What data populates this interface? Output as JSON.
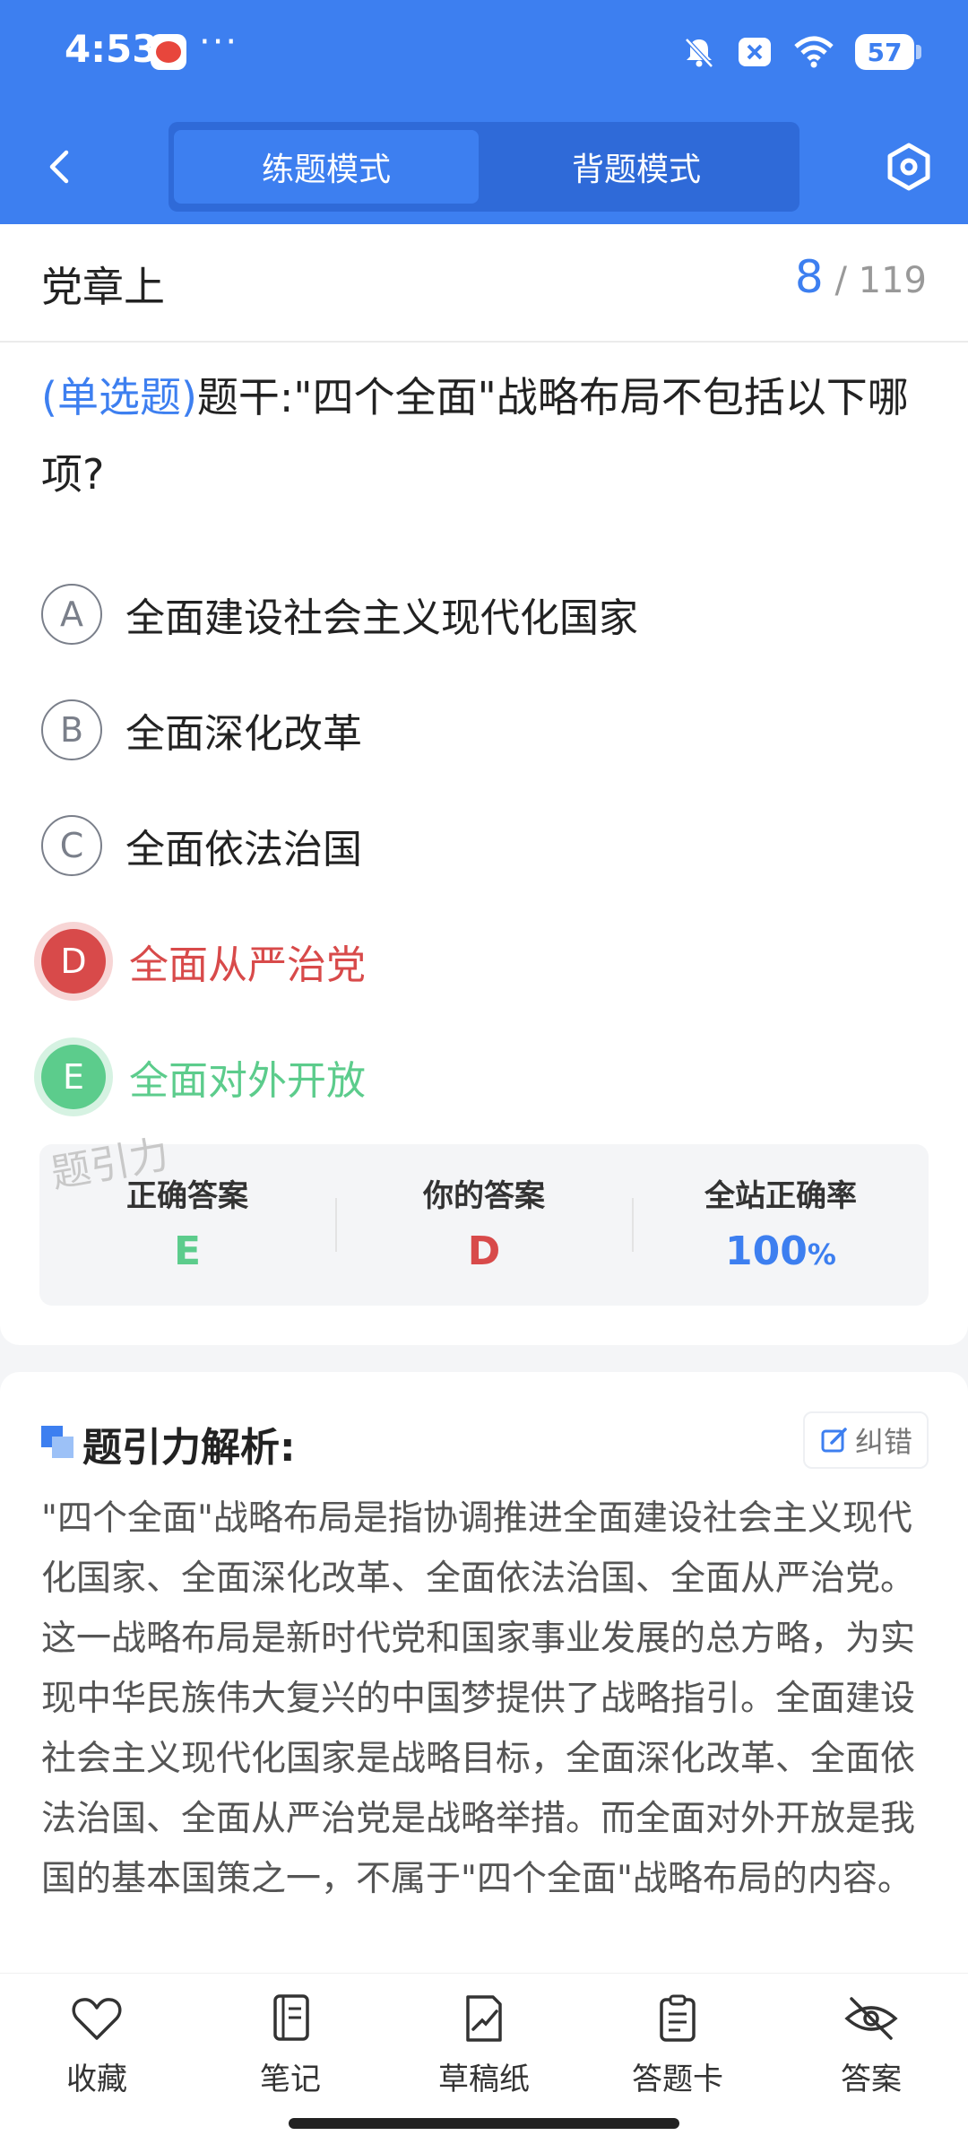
{
  "status_bar": {
    "time": "4:53",
    "dots": "···",
    "battery": "57"
  },
  "nav": {
    "tabs": [
      {
        "label": "练题模式",
        "active": true
      },
      {
        "label": "背题模式",
        "active": false
      }
    ]
  },
  "chapter": {
    "title": "党章上",
    "current": "8",
    "total": "119",
    "separator": " / "
  },
  "question": {
    "type": "(单选题)",
    "stem": "题干:\"四个全面\"战略布局不包括以下哪项?"
  },
  "options": [
    {
      "letter": "A",
      "text": "全面建设社会主义现代化国家",
      "state": "normal"
    },
    {
      "letter": "B",
      "text": "全面深化改革",
      "state": "normal"
    },
    {
      "letter": "C",
      "text": "全面依法治国",
      "state": "normal"
    },
    {
      "letter": "D",
      "text": "全面从严治党",
      "state": "wrong"
    },
    {
      "letter": "E",
      "text": "全面对外开放",
      "state": "correct"
    }
  ],
  "answer_summary": {
    "watermark": "题引力",
    "correct_label": "正确答案",
    "correct_value": "E",
    "yours_label": "你的答案",
    "yours_value": "D",
    "rate_label": "全站正确率",
    "rate_value": "100",
    "rate_unit": "%"
  },
  "analysis": {
    "title": "题引力解析:",
    "fix_label": "纠错",
    "text": "\"四个全面\"战略布局是指协调推进全面建设社会主义现代化国家、全面深化改革、全面依法治国、全面从严治党。这一战略布局是新时代党和国家事业发展的总方略，为实现中华民族伟大复兴的中国梦提供了战略指引。全面建设社会主义现代化国家是战略目标，全面深化改革、全面依法治国、全面从严治党是战略举措。而全面对外开放是我国的基本国策之一，不属于\"四个全面\"战略布局的内容。"
  },
  "toolbar": {
    "items": [
      {
        "label": "收藏",
        "icon": "heart-icon"
      },
      {
        "label": "笔记",
        "icon": "notebook-icon"
      },
      {
        "label": "草稿纸",
        "icon": "draft-icon"
      },
      {
        "label": "答题卡",
        "icon": "clipboard-icon"
      },
      {
        "label": "答案",
        "icon": "eye-off-icon"
      }
    ]
  },
  "colors": {
    "brand_blue": "#3d7ff0",
    "wrong_red": "#d84a4a",
    "correct_green": "#5ccc8c"
  }
}
